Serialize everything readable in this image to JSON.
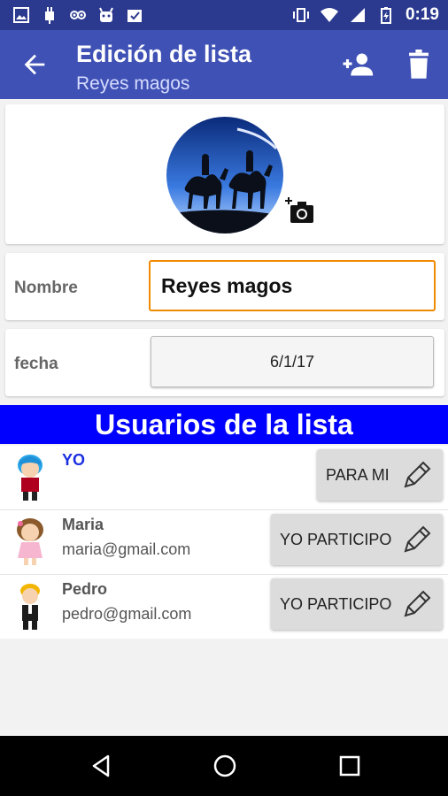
{
  "status_bar": {
    "time": "0:19"
  },
  "app_bar": {
    "title": "Edición de lista",
    "subtitle": "Reyes magos"
  },
  "form": {
    "name_label": "Nombre",
    "name_value": "Reyes magos",
    "date_label": "fecha",
    "date_value": "6/1/17"
  },
  "users_section": {
    "title": "Usuarios de la lista",
    "users": [
      {
        "name": "YO",
        "email": "",
        "role": "PARA MI"
      },
      {
        "name": "Maria",
        "email": "maria@gmail.com",
        "role": "YO PARTICIPO"
      },
      {
        "name": "Pedro",
        "email": "pedro@gmail.com",
        "role": "YO PARTICIPO"
      }
    ]
  },
  "colors": {
    "status_bar": "#2b3a8f",
    "app_bar": "#3f51b5",
    "section_header": "#0000ff",
    "input_focus": "#f08a00",
    "me_name": "#1a2fe0"
  },
  "icons": {
    "back": "arrow-back-icon",
    "add_user": "add-user-icon",
    "delete": "trash-icon",
    "camera": "add-photo-icon",
    "edit": "pencil-icon"
  }
}
